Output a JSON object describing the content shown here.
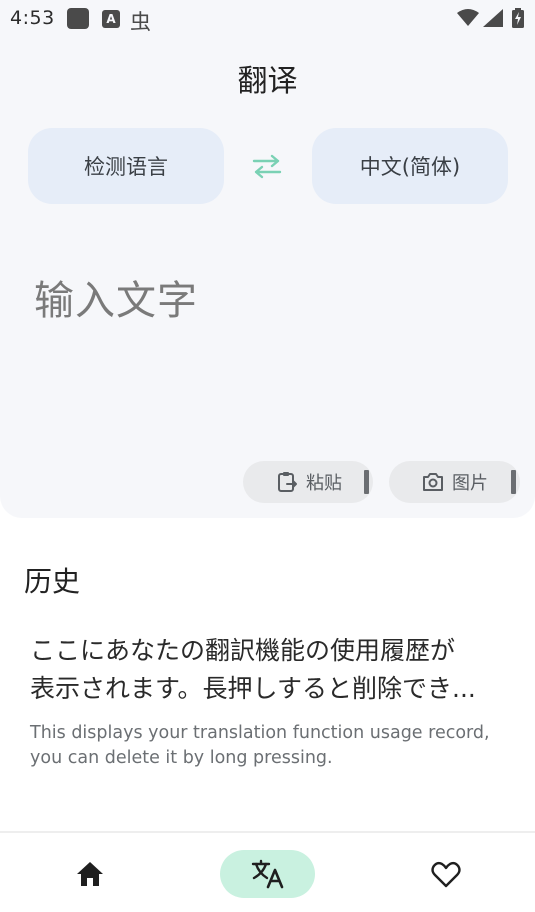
{
  "status_bar": {
    "time": "4:53",
    "icons": [
      "app-square-icon",
      "a-icon",
      "bug-icon",
      "wifi-icon",
      "signal-icon",
      "battery-charging-icon"
    ]
  },
  "translate": {
    "title": "翻译",
    "source_language": "检测语言",
    "target_language": "中文(简体)",
    "input_placeholder": "输入文字",
    "paste_label": "粘贴",
    "image_label": "图片"
  },
  "history": {
    "title": "历史",
    "empty_text_jp_line1": "ここにあなたの翻訳機能の使用履歴が",
    "empty_text_jp_line2": "表示されます。長押しすると削除でき...",
    "empty_text_en": "This displays your translation function usage record, you can delete it by long pressing."
  },
  "bottom_nav": {
    "items": [
      "home-icon",
      "translate-icon",
      "heart-icon"
    ],
    "active": "translate-icon"
  },
  "colors": {
    "background": "#f6f7fa",
    "language_button": "#e6edf8",
    "swap_accent": "#7ad1b4",
    "nav_active": "#c9f1e0"
  }
}
